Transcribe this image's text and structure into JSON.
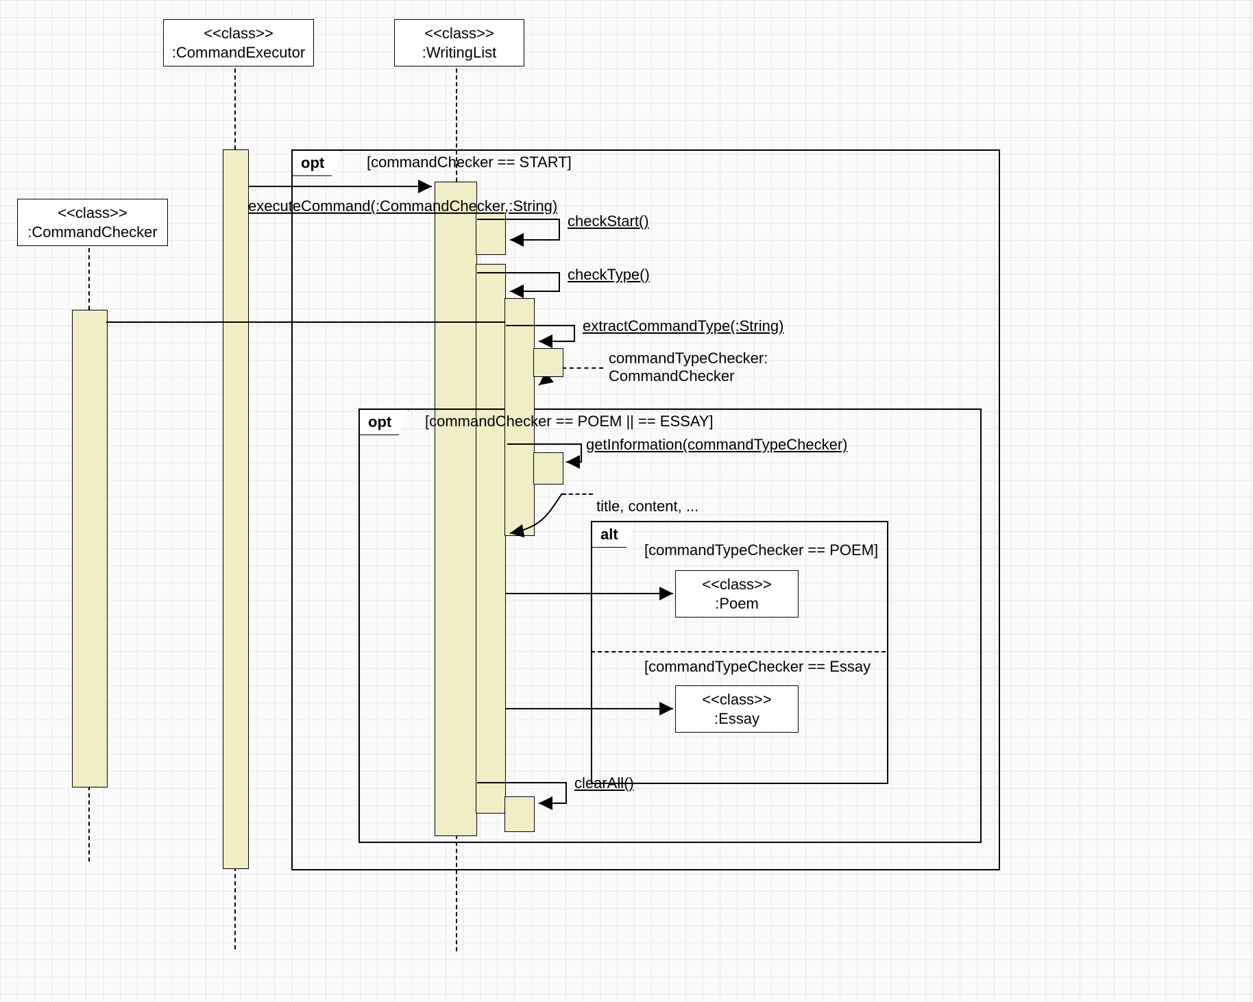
{
  "classes": {
    "stereotype": "<<class>>",
    "commandChecker": ":CommandChecker",
    "commandExecutor": ":CommandExecutor",
    "writingList": ":WritingList",
    "poem": ":Poem",
    "essay": ":Essay"
  },
  "frames": {
    "opt": "opt",
    "alt": "alt"
  },
  "guards": {
    "start": "[commandChecker == START]",
    "poemOrEssay": "[commandChecker == POEM || == ESSAY]",
    "poem": "[commandTypeChecker == POEM]",
    "essay": "[commandTypeChecker == Essay"
  },
  "messages": {
    "executeCommand": "executeCommand(:CommandChecker,:String)",
    "checkStart": "checkStart()",
    "checkType": "checkType()",
    "extractCommandType": "extractCommandType(:String)",
    "commandTypeCheckerLine1": "commandTypeChecker:",
    "commandTypeCheckerLine2": "CommandChecker",
    "getInformation": "getInformation(commandTypeChecker)",
    "titleContent": "title, content, ...",
    "clearAll": "clearAll()"
  }
}
